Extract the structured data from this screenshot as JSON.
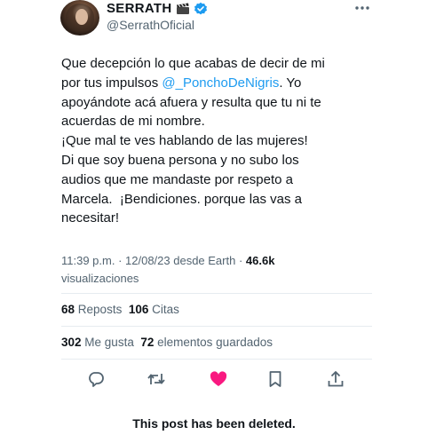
{
  "author": {
    "display_name": "SERRATH",
    "handle": "@SerrathOficial",
    "icons": [
      "clapper-board-icon",
      "verified-badge-icon",
      "more-options-icon"
    ],
    "verified_color": "#1d9bf0"
  },
  "tweet": {
    "line1": "Que decepción lo que acabas de decir de mi",
    "line2_prefix": "por tus impulsos ",
    "mention": "@_PonchoDeNigris",
    "line2_suffix": ". Yo",
    "rest": "apoyándote acá afuera y resulta que tu ni te\nacuerdas de mi nombre.\n¡Que mal te ves hablando de las mujeres!\nDi que soy buena persona y no subo los\naudios que me mandaste por respeto a\nMarcela.  ¡Bendiciones. porque las vas a\nnecesitar!",
    "mention_color": "#1d9bf0"
  },
  "meta": {
    "timestamp": "11:39 p.m. · 12/08/23 desde Earth · ",
    "views_count": "46.6k",
    "views_label": "visualizaciones"
  },
  "stats": {
    "reposts_count": "68",
    "reposts_label": "Reposts",
    "quotes_count": "106",
    "quotes_label": "Citas",
    "likes_count": "302",
    "likes_label": "Me gusta",
    "bookmarks_count": "72",
    "bookmarks_label": "elementos guardados"
  },
  "actions": {
    "icons": [
      "reply-icon",
      "repost-icon",
      "like-icon",
      "bookmark-icon",
      "share-icon"
    ],
    "like_color": "#f91880",
    "icon_color": "#536471"
  },
  "notice": {
    "deleted": "This post has been deleted."
  }
}
